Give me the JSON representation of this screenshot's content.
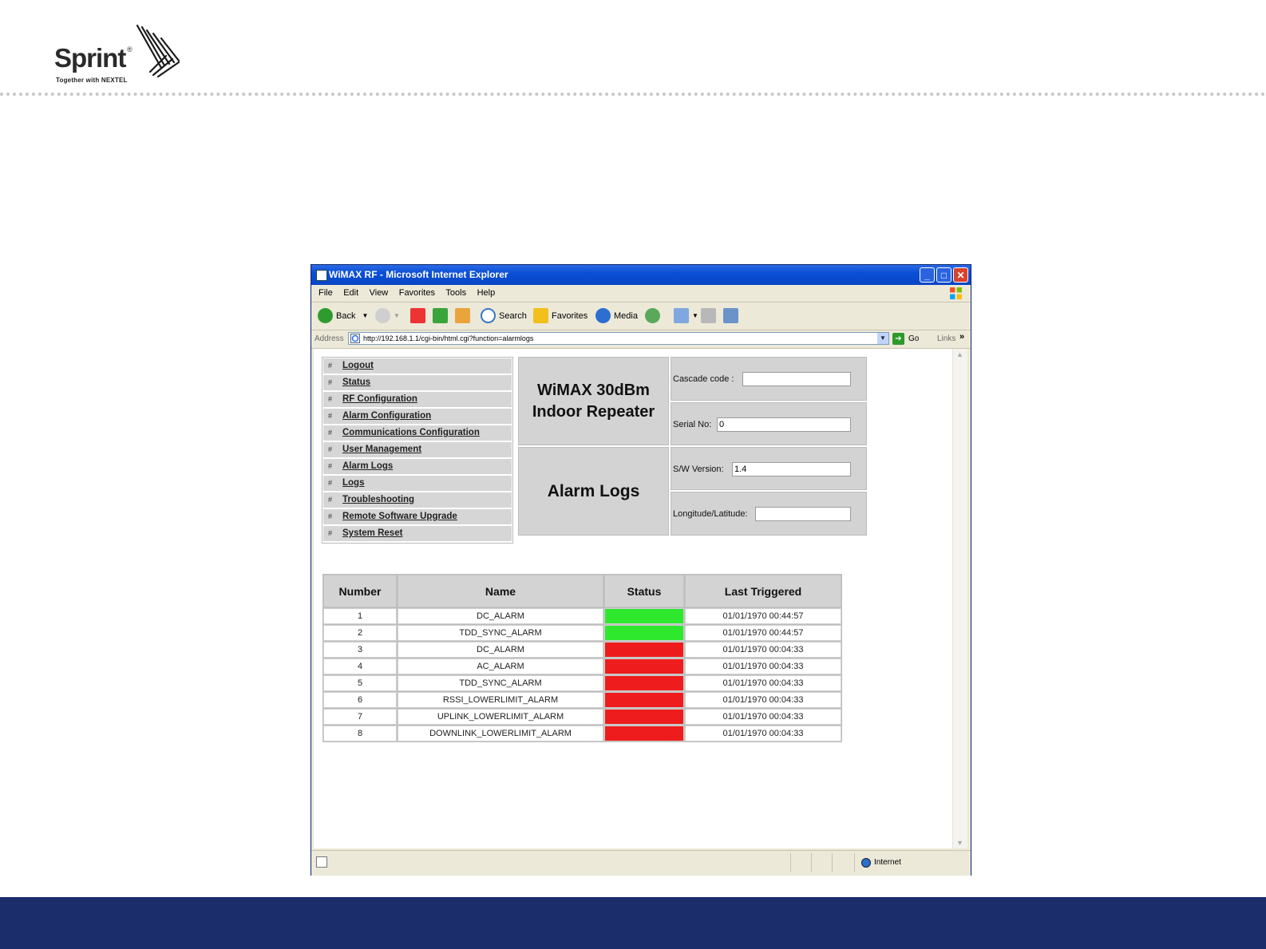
{
  "slide": {
    "logo_word": "Sprint",
    "logo_reg": "®",
    "logo_tagline": "Together with NEXTEL",
    "footer_color": "#1b2d6b"
  },
  "window": {
    "title": "WiMAX RF - Microsoft Internet Explorer",
    "buttons": {
      "minimize": "_",
      "maximize": "□",
      "close": "✕"
    }
  },
  "menu": [
    "File",
    "Edit",
    "View",
    "Favorites",
    "Tools",
    "Help"
  ],
  "toolbar": {
    "back": "Back",
    "search": "Search",
    "favorites": "Favorites",
    "media": "Media"
  },
  "address": {
    "label": "Address",
    "url": "http://192.168.1.1/cgi-bin/html.cgi?function=alarmlogs",
    "go": "Go",
    "links": "Links",
    "more": "»"
  },
  "nav": {
    "bullet": "#",
    "items": [
      "Logout",
      "Status",
      "RF Configuration",
      "Alarm Configuration",
      "Communications Configuration",
      "User Management",
      "Alarm Logs",
      "Logs",
      "Troubleshooting",
      "Remote Software Upgrade",
      "System Reset"
    ]
  },
  "device": {
    "title_line1": "WiMAX 30dBm",
    "title_line2": "Indoor Repeater",
    "page_title": "Alarm Logs",
    "cascade_label": "Cascade code :",
    "cascade_value": "",
    "serial_label": "Serial No:",
    "serial_value": "0",
    "sw_label": "S/W Version:",
    "sw_value": "1.4",
    "lonlat_label": "Longitude/Latitude:",
    "lonlat_value": ""
  },
  "alarm_table": {
    "headers": [
      "Number",
      "Name",
      "Status",
      "Last Triggered"
    ],
    "status_colors": {
      "ok": "#2ee82e",
      "alarm": "#ee1c1c"
    },
    "rows": [
      {
        "number": "1",
        "name": "DC_ALARM",
        "status": "ok",
        "last": "01/01/1970 00:44:57"
      },
      {
        "number": "2",
        "name": "TDD_SYNC_ALARM",
        "status": "ok",
        "last": "01/01/1970 00:44:57"
      },
      {
        "number": "3",
        "name": "DC_ALARM",
        "status": "alarm",
        "last": "01/01/1970 00:04:33"
      },
      {
        "number": "4",
        "name": "AC_ALARM",
        "status": "alarm",
        "last": "01/01/1970 00:04:33"
      },
      {
        "number": "5",
        "name": "TDD_SYNC_ALARM",
        "status": "alarm",
        "last": "01/01/1970 00:04:33"
      },
      {
        "number": "6",
        "name": "RSSI_LOWERLIMIT_ALARM",
        "status": "alarm",
        "last": "01/01/1970 00:04:33"
      },
      {
        "number": "7",
        "name": "UPLINK_LOWERLIMIT_ALARM",
        "status": "alarm",
        "last": "01/01/1970 00:04:33"
      },
      {
        "number": "8",
        "name": "DOWNLINK_LOWERLIMIT_ALARM",
        "status": "alarm",
        "last": "01/01/1970 00:04:33"
      }
    ]
  },
  "statusbar": {
    "zone": "Internet"
  }
}
